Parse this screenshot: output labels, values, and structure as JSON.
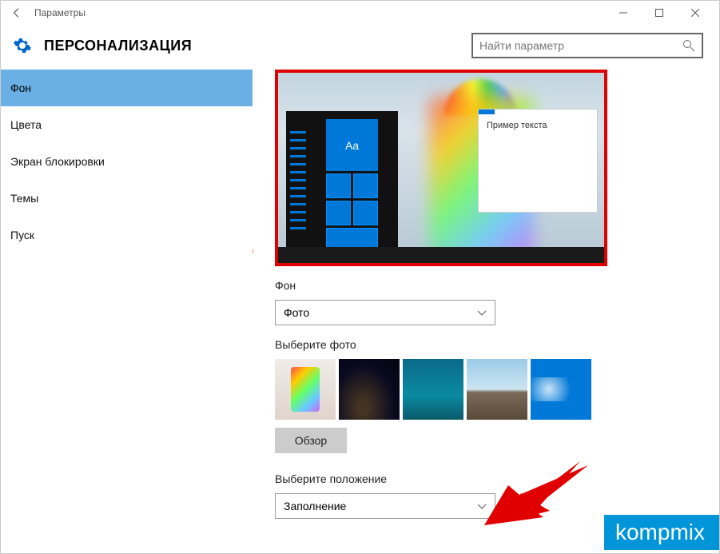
{
  "window": {
    "title": "Параметры"
  },
  "header": {
    "page_title": "ПЕРСОНАЛИЗАЦИЯ"
  },
  "search": {
    "placeholder": "Найти параметр"
  },
  "sidebar": {
    "items": [
      {
        "label": "Фон",
        "active": true
      },
      {
        "label": "Цвета",
        "active": false
      },
      {
        "label": "Экран блокировки",
        "active": false
      },
      {
        "label": "Темы",
        "active": false
      },
      {
        "label": "Пуск",
        "active": false
      }
    ]
  },
  "preview": {
    "tile_text": "Aa",
    "sample_text": "Пример текста"
  },
  "background": {
    "section_label": "Фон",
    "combo_value": "Фото"
  },
  "choose_photo": {
    "section_label": "Выберите фото",
    "thumbs": [
      "cake",
      "night",
      "ocean",
      "beach",
      "win10"
    ],
    "browse_label": "Обзор"
  },
  "choose_fit": {
    "section_label": "Выберите положение",
    "combo_value": "Заполнение"
  },
  "watermark": {
    "text": "kompmix",
    "sub": ""
  }
}
